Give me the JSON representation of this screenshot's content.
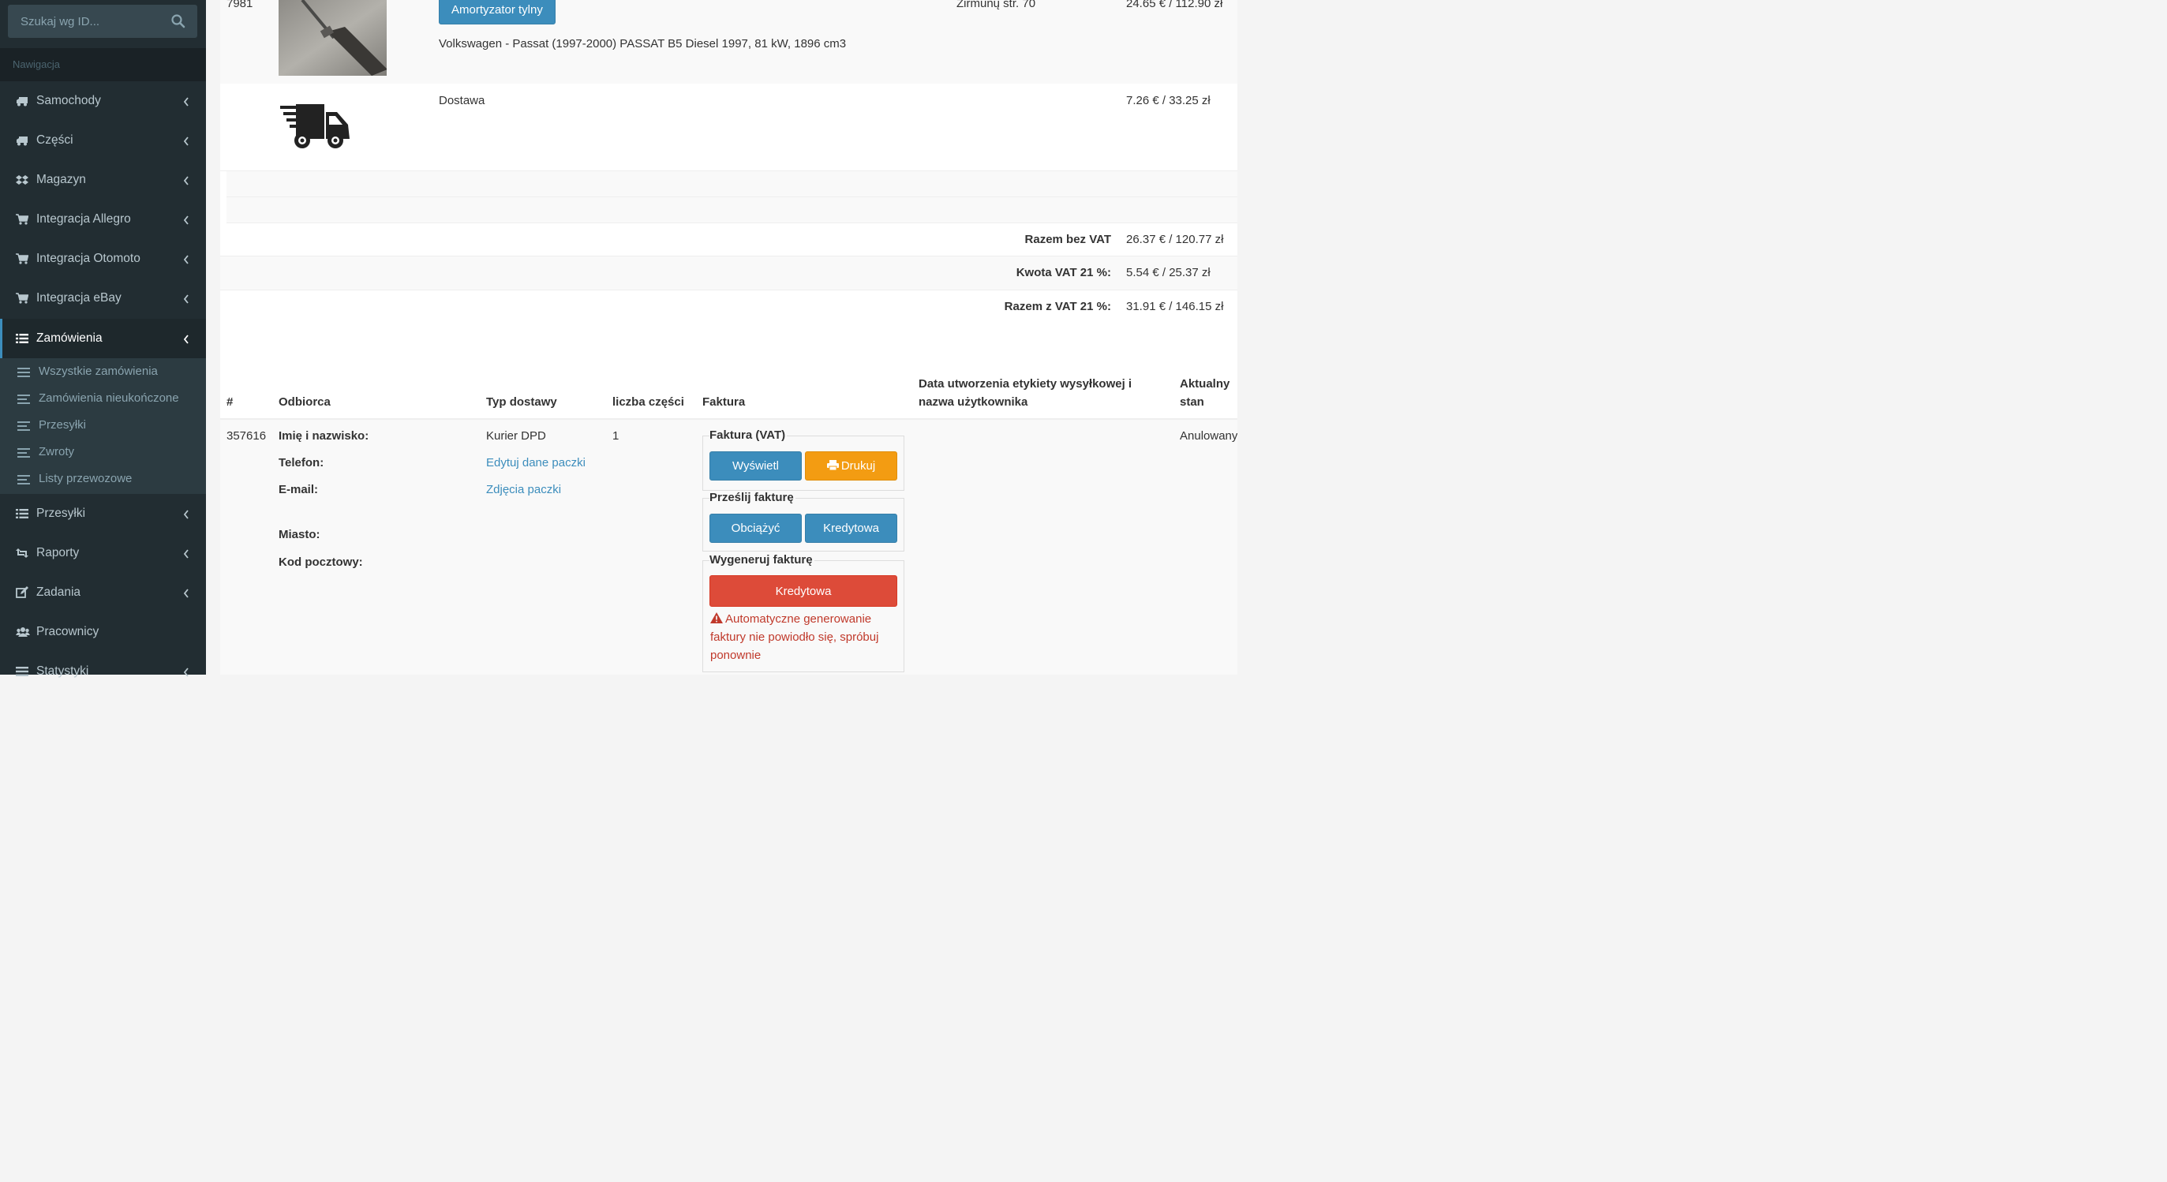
{
  "sidebar": {
    "search_placeholder": "Szukaj wg ID...",
    "nav_header": "Nawigacja",
    "items": [
      {
        "label": "Samochody",
        "icon": "truck-icon"
      },
      {
        "label": "Części",
        "icon": "truck-icon"
      },
      {
        "label": "Magazyn",
        "icon": "dropbox-icon"
      },
      {
        "label": "Integracja Allegro",
        "icon": "cart-icon"
      },
      {
        "label": "Integracja Otomoto",
        "icon": "cart-icon"
      },
      {
        "label": "Integracja eBay",
        "icon": "cart-icon"
      },
      {
        "label": "Zamówienia",
        "icon": "list-icon",
        "active": true
      },
      {
        "label": "Przesyłki",
        "icon": "list-icon"
      },
      {
        "label": "Raporty",
        "icon": "retweet-icon"
      },
      {
        "label": "Zadania",
        "icon": "edit-icon"
      },
      {
        "label": "Pracownicy",
        "icon": "users-icon"
      },
      {
        "label": "Statystyki",
        "icon": "list-icon"
      }
    ],
    "submenu": [
      {
        "label": "Wszystkie zamówienia",
        "icon": "list-icon"
      },
      {
        "label": "Zamówienia nieukończone",
        "icon": "align-left-icon"
      },
      {
        "label": "Przesyłki",
        "icon": "align-left-icon"
      },
      {
        "label": "Zwroty",
        "icon": "align-left-icon"
      },
      {
        "label": "Listy przewozowe",
        "icon": "align-left-icon"
      }
    ]
  },
  "items_table": {
    "part": {
      "id": "7981",
      "button": "Amortyzator tylny",
      "vehicle": "Volkswagen - Passat (1997-2000) PASSAT B5 Diesel 1997, 81 kW, 1896 cm3",
      "location": "Žirmūnų str. 70",
      "price": "24.65 € / 112.90 zł"
    },
    "delivery": {
      "label": "Dostawa",
      "price": "7.26 € / 33.25 zł"
    },
    "totals": [
      {
        "label": "Razem bez VAT",
        "value": "26.37 € / 120.77 zł"
      },
      {
        "label": "Kwota VAT 21 %:",
        "value": "5.54 € / 25.37 zł"
      },
      {
        "label": "Razem z VAT 21 %:",
        "value": "31.91 € / 146.15 zł"
      }
    ]
  },
  "order_table": {
    "headers": {
      "hash": "#",
      "recipient": "Odbiorca",
      "delivery_type": "Typ dostawy",
      "parts_count": "liczba części",
      "invoice": "Faktura",
      "label_date_line1": "Data utworzenia etykiety wysyłkowej i",
      "label_date_line2": "nazwa użytkownika",
      "status_line1": "Aktualny",
      "status_line2": "stan"
    },
    "row": {
      "id": "357616",
      "recipient_fields": {
        "name": "Imię i nazwisko:",
        "phone": "Telefon:",
        "email": "E-mail:",
        "city": "Miasto:",
        "postcode": "Kod pocztowy:"
      },
      "delivery_type": "Kurier DPD",
      "edit_package_link": "Edytuj dane paczki",
      "package_photos_link": "Zdjęcia paczki",
      "parts_count": "1",
      "invoice": {
        "vat_title": "Faktura (VAT)",
        "view_button": "Wyświetl",
        "print_button": "Drukuj",
        "send_title": "Prześlij fakturę",
        "debit_button": "Obciążyć",
        "credit_button": "Kredytowa",
        "generate_title": "Wygeneruj fakturę",
        "generate_credit_button": "Kredytowa",
        "error_message": "Automatyczne generowanie faktury nie powiodło się, spróbuj ponownie"
      },
      "status": "Anulowany"
    }
  },
  "colors": {
    "sidebar_bg": "#222d32",
    "primary": "#3c8dbc",
    "warning": "#f39c12",
    "danger": "#dd4b39"
  }
}
